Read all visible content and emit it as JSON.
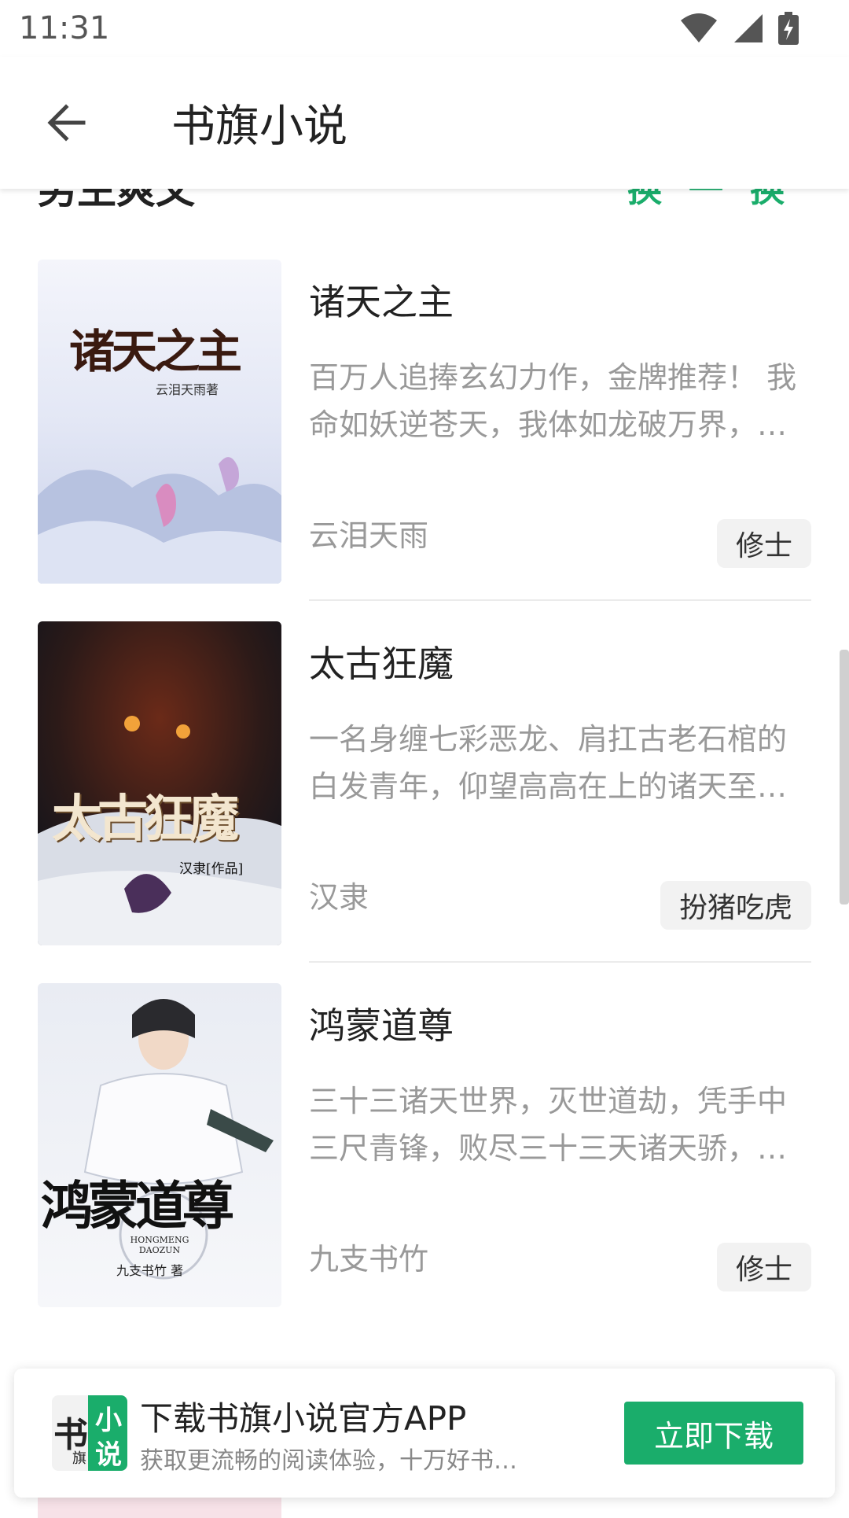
{
  "status_bar": {
    "time": "11:31"
  },
  "app_bar": {
    "title": "书旗小说",
    "back_icon": "arrow-left-icon"
  },
  "section": {
    "title": "男生爽文",
    "action": "换一换"
  },
  "books": [
    {
      "title": "诸天之主",
      "description": "百万人追捧玄幻力作，金牌推荐！ 我命如妖逆苍天，我体如龙破万界，…",
      "author": "云泪天雨",
      "tag": "修士",
      "cover_title": "诸天之主",
      "cover_author": "云泪天雨著"
    },
    {
      "title": "太古狂魔",
      "description": "一名身缠七彩恶龙、肩扛古老石棺的白发青年，仰望高高在上的诸天至…",
      "author": "汉隶",
      "tag": "扮猪吃虎",
      "cover_title": "太古狂魔",
      "cover_author": "汉隶[作品]"
    },
    {
      "title": "鸿蒙道尊",
      "description": "三十三诸天世界，灭世道劫，凭手中三尺青锋，败尽三十三天诸天骄，…",
      "author": "九支书竹",
      "tag": "修士",
      "cover_title": "鸿蒙道尊",
      "cover_author": "九支书竹 著",
      "cover_pinyin": "HONGMENG DAOZUN"
    }
  ],
  "banner": {
    "logo_text": [
      "书",
      "旗",
      "小",
      "说"
    ],
    "title": "下载书旗小说官方APP",
    "subtitle": "获取更流畅的阅读体验，十万好书…",
    "button": "立即下载"
  },
  "colors": {
    "accent": "#1aad6b"
  }
}
